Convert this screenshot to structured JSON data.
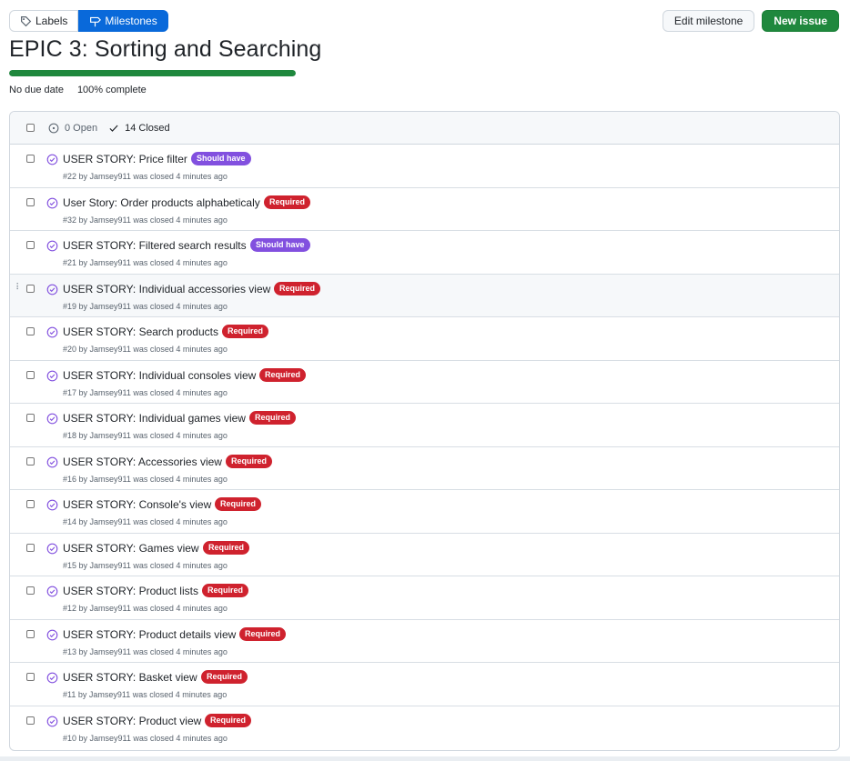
{
  "subnav": {
    "labels": "Labels",
    "milestones": "Milestones"
  },
  "actions": {
    "edit": "Edit milestone",
    "new_issue": "New issue"
  },
  "milestone": {
    "title": "EPIC 3: Sorting and Searching",
    "due": "No due date",
    "complete": "100% complete",
    "progress_fraction": 1.0
  },
  "list_header": {
    "open": "0 Open",
    "closed": "14 Closed"
  },
  "colors": {
    "should_have": "#8250df",
    "required": "#cf222e",
    "closed_icon": "#8250df"
  },
  "issues": [
    {
      "title": "USER STORY: Price filter",
      "label": "Should have",
      "label_type": "should_have",
      "sub": "#22 by Jamsey911 was closed 4 minutes ago"
    },
    {
      "title": "User Story: Order products alphabeticaly",
      "label": "Required",
      "label_type": "required",
      "sub": "#32 by Jamsey911 was closed 4 minutes ago"
    },
    {
      "title": "USER STORY: Filtered search results",
      "label": "Should have",
      "label_type": "should_have",
      "sub": "#21 by Jamsey911 was closed 4 minutes ago"
    },
    {
      "title": "USER STORY: Individual accessories view",
      "label": "Required",
      "label_type": "required",
      "sub": "#19 by Jamsey911 was closed 4 minutes ago"
    },
    {
      "title": "USER STORY: Search products",
      "label": "Required",
      "label_type": "required",
      "sub": "#20 by Jamsey911 was closed 4 minutes ago"
    },
    {
      "title": "USER STORY: Individual consoles view",
      "label": "Required",
      "label_type": "required",
      "sub": "#17 by Jamsey911 was closed 4 minutes ago"
    },
    {
      "title": "USER STORY: Individual games view",
      "label": "Required",
      "label_type": "required",
      "sub": "#18 by Jamsey911 was closed 4 minutes ago"
    },
    {
      "title": "USER STORY: Accessories view",
      "label": "Required",
      "label_type": "required",
      "sub": "#16 by Jamsey911 was closed 4 minutes ago"
    },
    {
      "title": "USER STORY: Console's view",
      "label": "Required",
      "label_type": "required",
      "sub": "#14 by Jamsey911 was closed 4 minutes ago"
    },
    {
      "title": "USER STORY: Games view",
      "label": "Required",
      "label_type": "required",
      "sub": "#15 by Jamsey911 was closed 4 minutes ago"
    },
    {
      "title": "USER STORY: Product lists",
      "label": "Required",
      "label_type": "required",
      "sub": "#12 by Jamsey911 was closed 4 minutes ago"
    },
    {
      "title": "USER STORY: Product details view",
      "label": "Required",
      "label_type": "required",
      "sub": "#13 by Jamsey911 was closed 4 minutes ago"
    },
    {
      "title": "USER STORY: Basket view",
      "label": "Required",
      "label_type": "required",
      "sub": "#11 by Jamsey911 was closed 4 minutes ago"
    },
    {
      "title": "USER STORY: Product view",
      "label": "Required",
      "label_type": "required",
      "sub": "#10 by Jamsey911 was closed 4 minutes ago"
    }
  ]
}
